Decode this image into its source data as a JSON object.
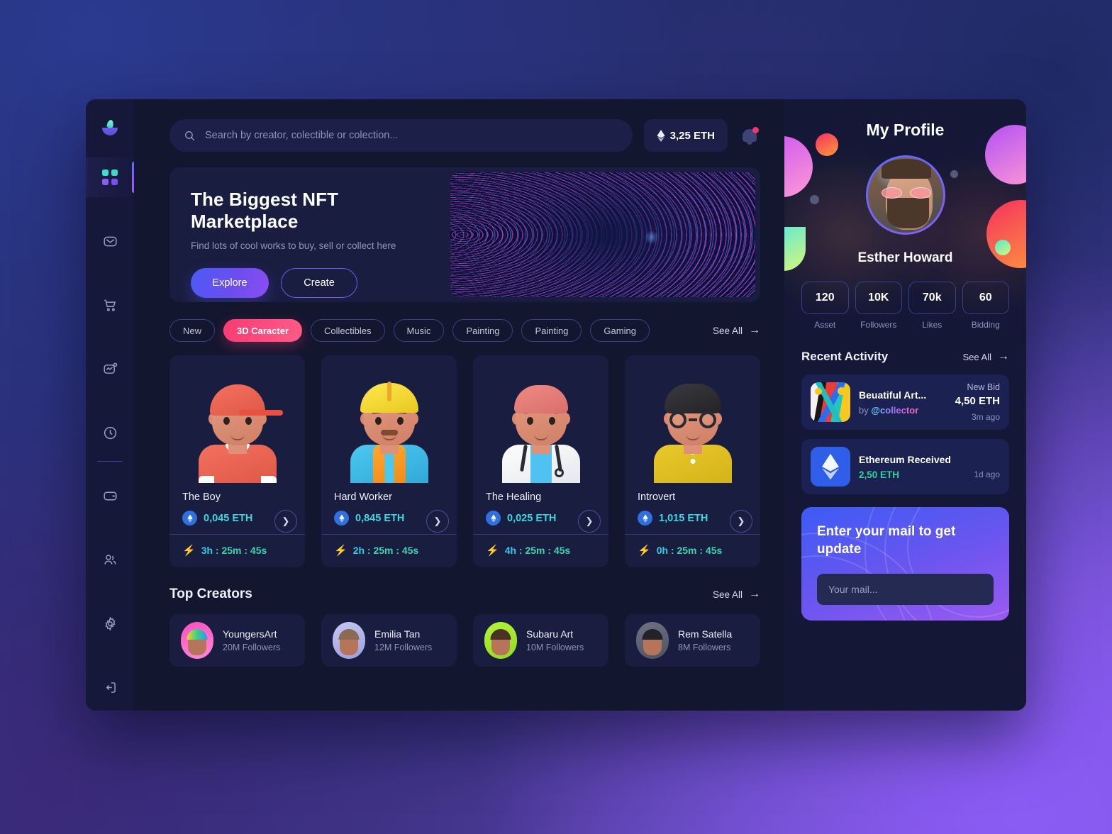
{
  "sidebar": {
    "logo_name": "nft-logo",
    "items": [
      {
        "icon": "grid-icon",
        "name": "dashboard",
        "active": true
      },
      {
        "icon": "mail-icon",
        "name": "messages",
        "active": false
      },
      {
        "icon": "cart-icon",
        "name": "cart",
        "active": false
      },
      {
        "icon": "analytics-icon",
        "name": "analytics",
        "active": false
      },
      {
        "icon": "clock-icon",
        "name": "history",
        "active": false
      },
      {
        "icon": "wallet-icon",
        "name": "wallet",
        "active": false
      },
      {
        "icon": "users-icon",
        "name": "community",
        "active": false
      },
      {
        "icon": "gear-icon",
        "name": "settings",
        "active": false
      },
      {
        "icon": "logout-icon",
        "name": "logout",
        "active": false
      }
    ]
  },
  "topbar": {
    "search_placeholder": "Search by creator, colectible or colection...",
    "search_value": "",
    "balance": "3,25 ETH",
    "notification_dot": true
  },
  "hero": {
    "title": "The Biggest NFT Marketplace",
    "subtitle": "Find lots of cool works to buy, sell or collect here",
    "primary_button": "Explore",
    "secondary_button": "Create"
  },
  "categories": {
    "items": [
      {
        "label": "New",
        "active": false
      },
      {
        "label": "3D Caracter",
        "active": true
      },
      {
        "label": "Collectibles",
        "active": false
      },
      {
        "label": "Music",
        "active": false
      },
      {
        "label": "Painting",
        "active": false
      },
      {
        "label": "Painting",
        "active": false
      },
      {
        "label": "Gaming",
        "active": false
      }
    ],
    "see_all": "See All"
  },
  "nfts": [
    {
      "title": "The Boy",
      "price": "0,045 ETH",
      "time_h": "3h",
      "time_rest": " : 25m : 45s"
    },
    {
      "title": "Hard Worker",
      "price": "0,845 ETH",
      "time_h": "2h",
      "time_rest": " : 25m : 45s"
    },
    {
      "title": "The Healing",
      "price": "0,025 ETH",
      "time_h": "4h",
      "time_rest": " : 25m : 45s"
    },
    {
      "title": "Introvert",
      "price": "1,015 ETH",
      "time_h": "0h",
      "time_rest": " : 25m : 45s"
    }
  ],
  "creators": {
    "heading": "Top Creators",
    "see_all": "See All",
    "items": [
      {
        "name": "YoungersArt",
        "followers": "20M Followers"
      },
      {
        "name": "Emilia Tan",
        "followers": "12M Followers"
      },
      {
        "name": "Subaru Art",
        "followers": "10M Followers"
      },
      {
        "name": "Rem Satella",
        "followers": "8M Followers"
      }
    ]
  },
  "profile": {
    "title": "My Profile",
    "name": "Esther Howard",
    "stats": [
      {
        "value": "120",
        "label": "Asset"
      },
      {
        "value": "10K",
        "label": "Followers"
      },
      {
        "value": "70k",
        "label": "Likes"
      },
      {
        "value": "60",
        "label": "Bidding"
      }
    ]
  },
  "activity": {
    "heading": "Recent Activity",
    "see_all": "See All",
    "items": [
      {
        "title": "Beuatiful Art...",
        "by_prefix": "by ",
        "handle": "@collector",
        "tag": "New Bid",
        "amount": "4,50 ETH",
        "ago": "3m ago"
      },
      {
        "title": "Ethereum Received",
        "amount_green": "2,50 ETH",
        "ago": "1d ago"
      }
    ]
  },
  "newsletter": {
    "heading": "Enter your mail to get update",
    "placeholder": "Your mail...",
    "value": ""
  },
  "colors": {
    "accent_pink": "#fa3c73",
    "accent_purple": "#6a5cf0",
    "price_cyan": "#3bd8e0",
    "time_green": "#39d5b0",
    "panel_bg": "#141735",
    "main_bg": "#13162f",
    "card_bg": "#191d3f"
  }
}
